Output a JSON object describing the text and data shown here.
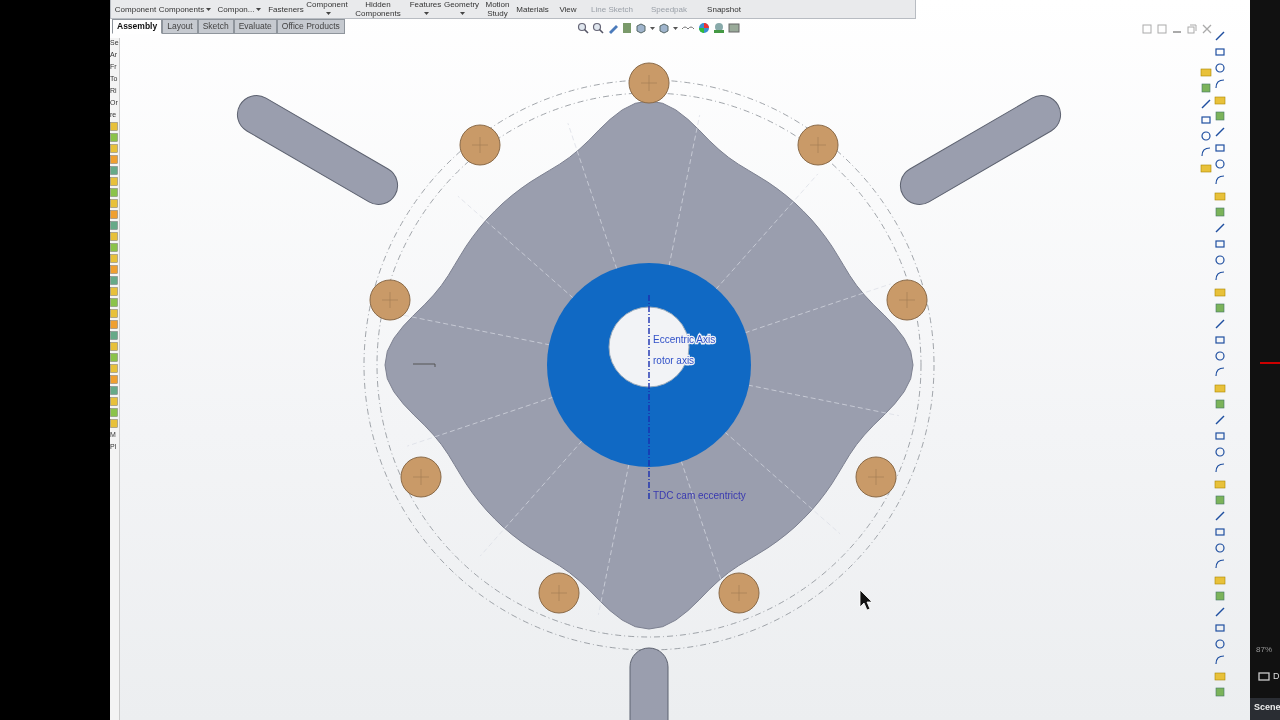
{
  "toolbar": {
    "items": [
      {
        "label": "Component",
        "dropdown": false,
        "disabled": false
      },
      {
        "label": "Components",
        "dropdown": true,
        "disabled": false
      },
      {
        "label": "Compon...",
        "dropdown": true,
        "disabled": false
      },
      {
        "label": "Fasteners",
        "dropdown": false,
        "disabled": false
      },
      {
        "label": "Component",
        "dropdown": true,
        "disabled": false
      },
      {
        "label": "Hidden Components",
        "dropdown": false,
        "disabled": false
      },
      {
        "label": "Features",
        "dropdown": true,
        "disabled": false
      },
      {
        "label": "Geometry",
        "dropdown": true,
        "disabled": false
      },
      {
        "label": "Motion Study",
        "dropdown": false,
        "disabled": false
      },
      {
        "label": "Materials",
        "dropdown": false,
        "disabled": false
      },
      {
        "label": "View",
        "dropdown": false,
        "disabled": false
      },
      {
        "label": "Line Sketch",
        "dropdown": false,
        "disabled": true
      },
      {
        "label": "Speedpak",
        "dropdown": false,
        "disabled": true
      },
      {
        "label": "Snapshot",
        "dropdown": false,
        "disabled": false
      }
    ]
  },
  "tabs": [
    {
      "label": "Assembly",
      "selected": true
    },
    {
      "label": "Layout",
      "selected": false
    },
    {
      "label": "Sketch",
      "selected": false
    },
    {
      "label": "Evaluate",
      "selected": false
    },
    {
      "label": "Office Products",
      "selected": false
    }
  ],
  "feature_tree": {
    "fragments_top": [
      "Se",
      "Ar",
      "Fr",
      "To",
      "Ri",
      "Or",
      "re"
    ],
    "fragments_bottom": [
      "M",
      "Pl"
    ]
  },
  "canvas": {
    "annotations": [
      {
        "text": "Eccentric Axis",
        "kind": "axis"
      },
      {
        "text": "rotor axis",
        "kind": "axis"
      },
      {
        "text": "TDC cam eccentricty",
        "kind": "point"
      }
    ]
  },
  "side_panel": {
    "zoom": "87%",
    "item": "D",
    "tab": "Scene"
  }
}
